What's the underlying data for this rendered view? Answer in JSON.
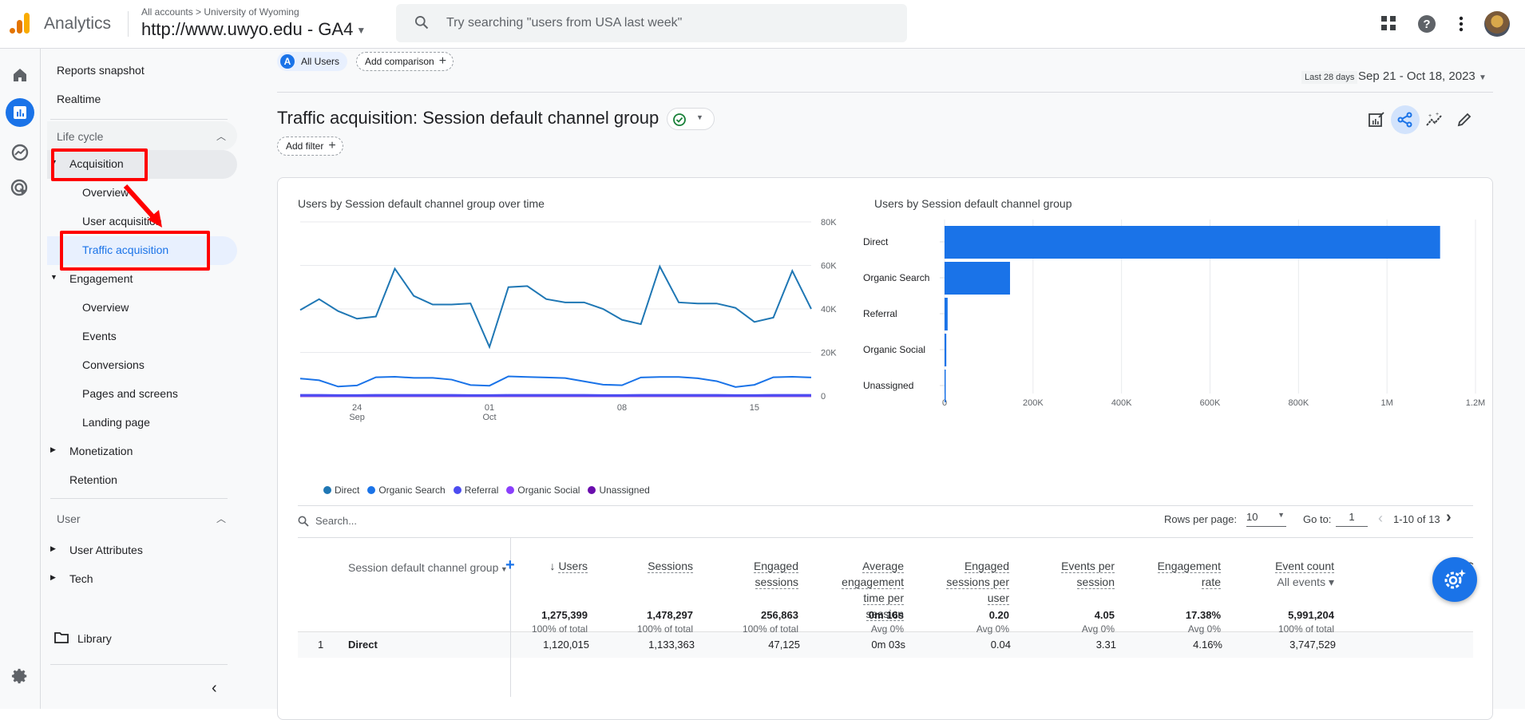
{
  "header": {
    "app_name": "Analytics",
    "breadcrumb": "All accounts > University of Wyoming",
    "property": "http://www.uwyo.edu - GA4",
    "search_placeholder": "Try searching \"users from USA last week\""
  },
  "nav": {
    "reports_snapshot": "Reports snapshot",
    "realtime": "Realtime",
    "lifecycle_section": "Life cycle",
    "acquisition": "Acquisition",
    "acq_overview": "Overview",
    "user_acquisition": "User acquisition",
    "traffic_acquisition": "Traffic acquisition",
    "engagement": "Engagement",
    "eng_overview": "Overview",
    "events": "Events",
    "conversions": "Conversions",
    "pages_and_screens": "Pages and screens",
    "landing_page": "Landing page",
    "monetization": "Monetization",
    "retention": "Retention",
    "user_section": "User",
    "user_attributes": "User Attributes",
    "tech": "Tech",
    "library": "Library"
  },
  "toolbar": {
    "segment_badge": "A",
    "segment": "All Users",
    "add_comparison": "Add comparison",
    "date_preset": "Last 28 days",
    "date_range": "Sep 21 - Oct 18, 2023",
    "add_filter": "Add filter"
  },
  "page": {
    "title": "Traffic acquisition: Session default channel group"
  },
  "colors": {
    "accent": "#1a73e8",
    "direct": "#1f77b4",
    "organic_search": "#1a73e8",
    "referral": "#4c4cf0",
    "organic_social": "#8a3ffc",
    "unassigned": "#6a0dad",
    "annotation": "#ff0000"
  },
  "chart_data": [
    {
      "type": "line",
      "title": "Users by Session default channel group over time",
      "x": [
        "Sep 21",
        "Sep 22",
        "Sep 23",
        "Sep 24",
        "Sep 25",
        "Sep 26",
        "Sep 27",
        "Sep 28",
        "Sep 29",
        "Sep 30",
        "Oct 01",
        "Oct 02",
        "Oct 03",
        "Oct 04",
        "Oct 05",
        "Oct 06",
        "Oct 07",
        "Oct 08",
        "Oct 09",
        "Oct 10",
        "Oct 11",
        "Oct 12",
        "Oct 13",
        "Oct 14",
        "Oct 15",
        "Oct 16",
        "Oct 17",
        "Oct 18"
      ],
      "x_tick_labels": [
        {
          "label": "24",
          "sublabel": "Sep",
          "index": 3
        },
        {
          "label": "01",
          "sublabel": "Oct",
          "index": 10
        },
        {
          "label": "08",
          "sublabel": "",
          "index": 17
        },
        {
          "label": "15",
          "sublabel": "",
          "index": 24
        }
      ],
      "y_ticks": [
        "0",
        "20K",
        "40K",
        "60K",
        "80K"
      ],
      "ylim": [
        0,
        80000
      ],
      "y_axis_side": "right",
      "grid": true,
      "legend_position": "bottom-left",
      "series": [
        {
          "name": "Direct",
          "values": [
            39500,
            44500,
            39000,
            35500,
            36500,
            58500,
            46000,
            42000,
            42000,
            42500,
            22500,
            50000,
            50500,
            44500,
            43000,
            43000,
            40000,
            35000,
            33000,
            59500,
            43000,
            42500,
            42500,
            40500,
            34000,
            36000,
            57500,
            40000
          ]
        },
        {
          "name": "Organic Search",
          "values": [
            8000,
            7200,
            4300,
            4800,
            8600,
            8800,
            8300,
            8300,
            7500,
            5000,
            4700,
            9000,
            8700,
            8500,
            8200,
            6700,
            5200,
            4900,
            8500,
            8700,
            8700,
            8100,
            6800,
            4100,
            5100,
            8600,
            8800,
            8500
          ]
        },
        {
          "name": "Referral",
          "values": [
            300,
            300,
            250,
            250,
            300,
            300,
            300,
            300,
            300,
            250,
            250,
            300,
            300,
            300,
            300,
            300,
            250,
            250,
            300,
            300,
            300,
            300,
            300,
            250,
            250,
            300,
            300,
            300
          ]
        },
        {
          "name": "Organic Social",
          "values": [
            200,
            200,
            150,
            150,
            200,
            200,
            200,
            200,
            200,
            150,
            150,
            200,
            200,
            200,
            200,
            200,
            150,
            150,
            200,
            200,
            200,
            200,
            200,
            150,
            150,
            200,
            200,
            200
          ]
        },
        {
          "name": "Unassigned",
          "values": [
            50,
            50,
            40,
            40,
            50,
            50,
            50,
            50,
            50,
            40,
            40,
            50,
            50,
            50,
            50,
            50,
            40,
            40,
            50,
            50,
            50,
            50,
            50,
            40,
            40,
            50,
            50,
            50
          ]
        }
      ]
    },
    {
      "type": "bar",
      "orientation": "horizontal",
      "title": "Users by Session default channel group",
      "categories": [
        "Direct",
        "Organic Search",
        "Referral",
        "Organic Social",
        "Unassigned"
      ],
      "values": [
        1120015,
        148000,
        7000,
        4000,
        1500
      ],
      "x_ticks": [
        "0",
        "200K",
        "400K",
        "600K",
        "800K",
        "1M",
        "1.2M"
      ],
      "xlim": [
        0,
        1200000
      ],
      "grid": true
    }
  ],
  "table": {
    "search_placeholder": "Search...",
    "rows_per_page_label": "Rows per page:",
    "rows_per_page": "10",
    "goto_label": "Go to:",
    "goto_value": "1",
    "range": "1-10 of 13",
    "dimension_header": "Session default channel group",
    "columns": [
      {
        "lines": [
          "Users"
        ],
        "sorted": true,
        "total": "1,275,399",
        "total_sub": "100% of total"
      },
      {
        "lines": [
          "Sessions"
        ],
        "total": "1,478,297",
        "total_sub": "100% of total"
      },
      {
        "lines": [
          "Engaged",
          "sessions"
        ],
        "total": "256,863",
        "total_sub": "100% of total"
      },
      {
        "lines": [
          "Average",
          "engagement",
          "time per",
          "session"
        ],
        "total": "0m 16s",
        "total_sub": "Avg 0%"
      },
      {
        "lines": [
          "Engaged",
          "sessions per",
          "user"
        ],
        "total": "0.20",
        "total_sub": "Avg 0%"
      },
      {
        "lines": [
          "Events per",
          "session"
        ],
        "total": "4.05",
        "total_sub": "Avg 0%"
      },
      {
        "lines": [
          "Engagement",
          "rate"
        ],
        "total": "17.38%",
        "total_sub": "Avg 0%"
      },
      {
        "lines": [
          "Event count"
        ],
        "selector": "All events",
        "total": "5,991,204",
        "total_sub": "100% of total"
      },
      {
        "lines": [
          "C"
        ],
        "selector": "Al",
        "total": "",
        "total_sub": ""
      }
    ],
    "rows": [
      {
        "rank": "1",
        "channel": "Direct",
        "values": [
          "1,120,015",
          "1,133,363",
          "47,125",
          "0m 03s",
          "0.04",
          "3.31",
          "4.16%",
          "3,747,529"
        ]
      }
    ]
  }
}
